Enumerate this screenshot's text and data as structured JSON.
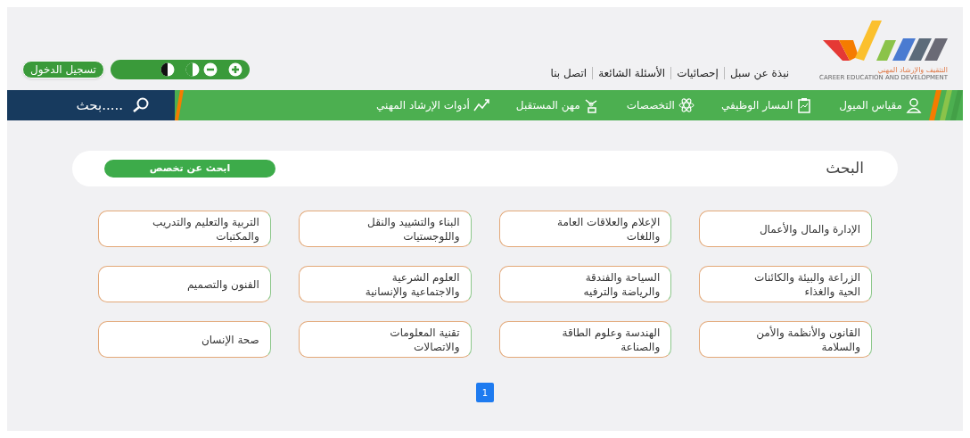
{
  "header": {
    "logo": {
      "arabic": "التثقيف والإرشاد المهني",
      "english": "CAREER EDUCATION AND DEVELOPMENT"
    },
    "links": [
      "نبذة عن سبل",
      "إحصائيات",
      "الأسئلة الشائعة",
      "اتصل بنا"
    ],
    "accessibility": [
      {
        "kind": "zoom-in"
      },
      {
        "kind": "zoom-out"
      },
      {
        "kind": "contrast-half"
      },
      {
        "kind": "contrast-full"
      }
    ],
    "login_button": "تسجيل الدخول"
  },
  "nav": {
    "items": [
      {
        "label": "مقياس الميول"
      },
      {
        "label": "المسار الوظيفي"
      },
      {
        "label": "التخصصات"
      },
      {
        "label": "مهن المستقبل"
      },
      {
        "label": "أدوات الإرشاد المهني"
      }
    ],
    "search": {
      "placeholder": "بحث....."
    }
  },
  "search_panel": {
    "title": "البحث",
    "button": "ابحث عن تخصص"
  },
  "specializations": [
    {
      "label": "الإدارة والمال والأعمال"
    },
    {
      "label": "الإعلام والعلاقات العامة\nواللغات"
    },
    {
      "label": "البناء والتشييد والنقل\nواللوجستيات"
    },
    {
      "label": "التربية والتعليم والتدريب\nوالمكتبات"
    },
    {
      "label": "الزراعة والبيئة والكائنات\nالحية والغذاء"
    },
    {
      "label": "السياحة والفندقة\nوالرياضة والترفيه"
    },
    {
      "label": "العلوم الشرعية\nوالاجتماعية والإنسانية"
    },
    {
      "label": "الفنون والتصميم"
    },
    {
      "label": "القانون والأنظمة والأمن\nوالسلامة"
    },
    {
      "label": "الهندسة وعلوم الطاقة\nوالصناعة"
    },
    {
      "label": "تقنية المعلومات\nوالاتصالات"
    },
    {
      "label": "صحة الإنسان"
    }
  ],
  "pagination": [
    {
      "label": "1",
      "selected": true
    }
  ]
}
